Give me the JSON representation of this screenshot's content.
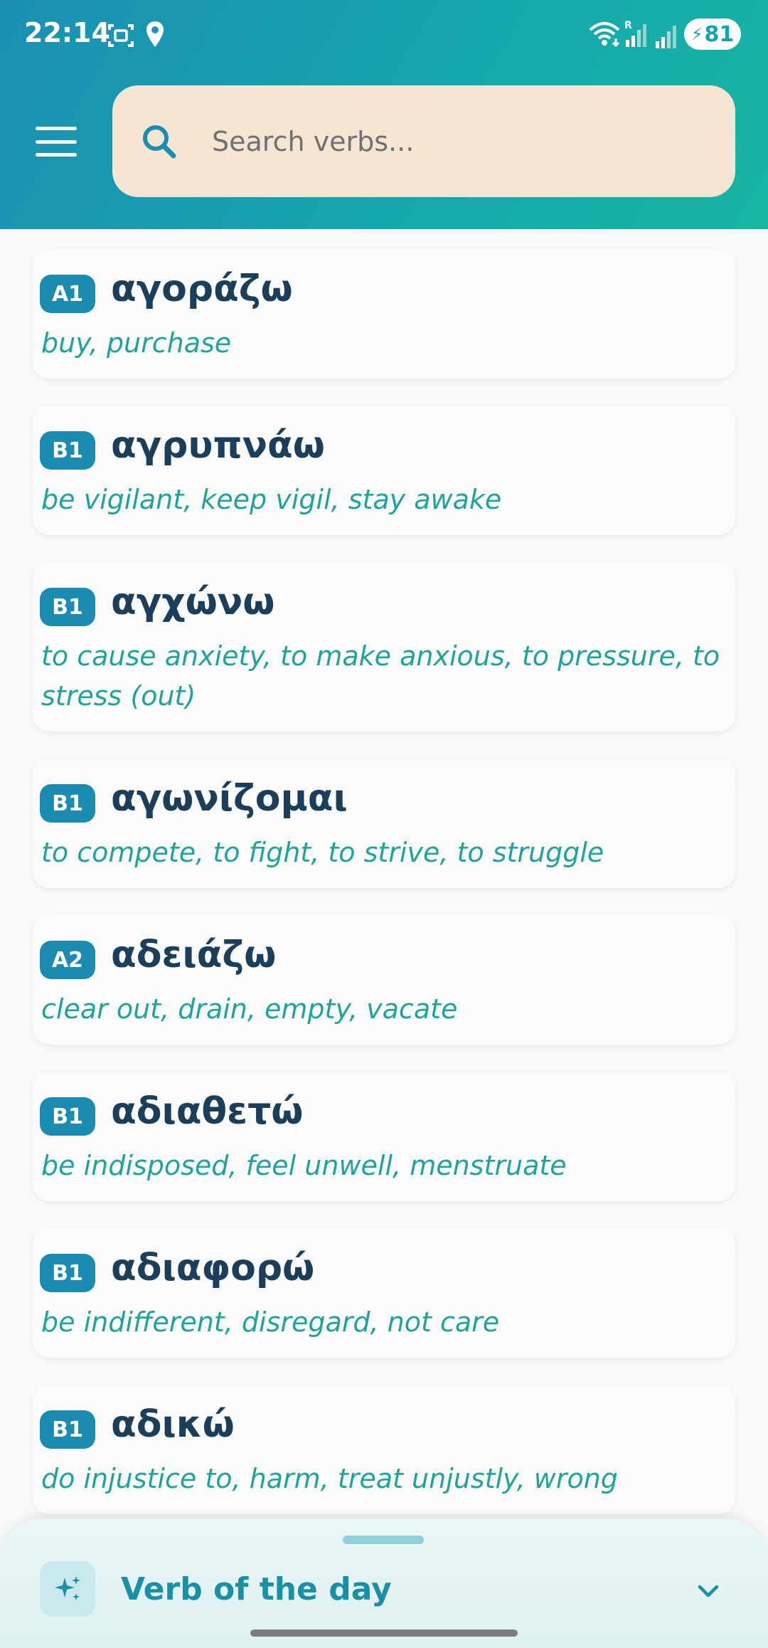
{
  "status": {
    "time": "22:14",
    "battery": "81",
    "signal_label": "R"
  },
  "search": {
    "placeholder": "Search verbs..."
  },
  "verbs": [
    {
      "level": "A1",
      "verb": "αγοράζω",
      "meaning": "buy, purchase"
    },
    {
      "level": "B1",
      "verb": "αγρυπνάω",
      "meaning": "be vigilant, keep vigil, stay awake"
    },
    {
      "level": "B1",
      "verb": "αγχώνω",
      "meaning": "to cause anxiety, to make anxious, to pressure, to stress (out)"
    },
    {
      "level": "B1",
      "verb": "αγωνίζομαι",
      "meaning": "to compete, to fight, to strive, to struggle"
    },
    {
      "level": "A2",
      "verb": "αδειάζω",
      "meaning": "clear out, drain, empty, vacate"
    },
    {
      "level": "B1",
      "verb": "αδιαθετώ",
      "meaning": "be indisposed, feel unwell, menstruate"
    },
    {
      "level": "B1",
      "verb": "αδιαφορώ",
      "meaning": "be indifferent, disregard, not care"
    },
    {
      "level": "B1",
      "verb": "αδικώ",
      "meaning": "do injustice to, harm, treat unjustly, wrong"
    }
  ],
  "sheet": {
    "title": "Verb of the day"
  },
  "colors": {
    "header_start": "#1c8fb2",
    "header_end": "#17b6a2",
    "badge": "#1b8cb0",
    "verb_text": "#1b3f5a",
    "meaning_text": "#1fa39a",
    "search_bg": "#f5e6d4"
  }
}
